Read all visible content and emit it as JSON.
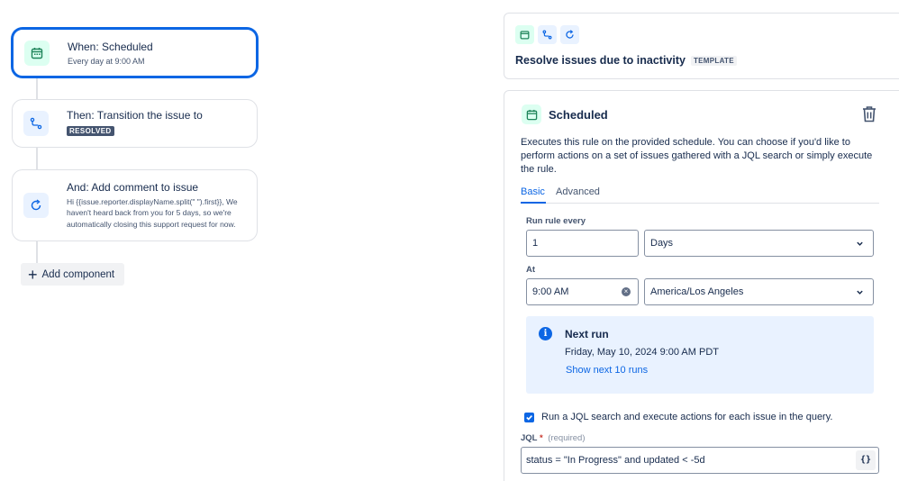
{
  "flow": {
    "trigger": {
      "title": "When: Scheduled",
      "subtitle": "Every day at 9:00 AM"
    },
    "action": {
      "title": "Then: Transition the issue to",
      "lozenge": "RESOLVED"
    },
    "comment": {
      "title": "And: Add comment to issue",
      "body": "Hi {{issue.reporter.displayName.split(\" \").first}}, We haven't heard back from you for 5 days, so we're automatically closing this support request for now."
    },
    "add_label": "Add component"
  },
  "rule": {
    "title": "Resolve issues due to inactivity",
    "tag": "TEMPLATE"
  },
  "panel": {
    "title": "Scheduled",
    "description": "Executes this rule on the provided schedule. You can choose if you'd like to perform actions on a set of issues gathered with a JQL search or simply execute the rule.",
    "tabs": [
      "Basic",
      "Advanced"
    ],
    "run_every_label": "Run rule every",
    "run_every_value": "1",
    "unit_value": "Days",
    "at_label": "At",
    "time_value": "9:00 AM",
    "timezone_value": "America/Los Angeles",
    "next_run": {
      "title": "Next run",
      "date": "Friday, May 10, 2024 9:00 AM PDT",
      "link": "Show next 10 runs"
    },
    "jql_checkbox_label": "Run a JQL search and execute actions for each issue in the query.",
    "jql_label": "JQL",
    "jql_required": "*",
    "jql_optional": "(required)",
    "jql_value": "status = \"In Progress\" and updated < -5d",
    "jql_button": "{}"
  },
  "colors": {
    "accent": "#0c66e4",
    "green_bg": "#dcfff1",
    "info_bg": "#e9f2ff"
  }
}
